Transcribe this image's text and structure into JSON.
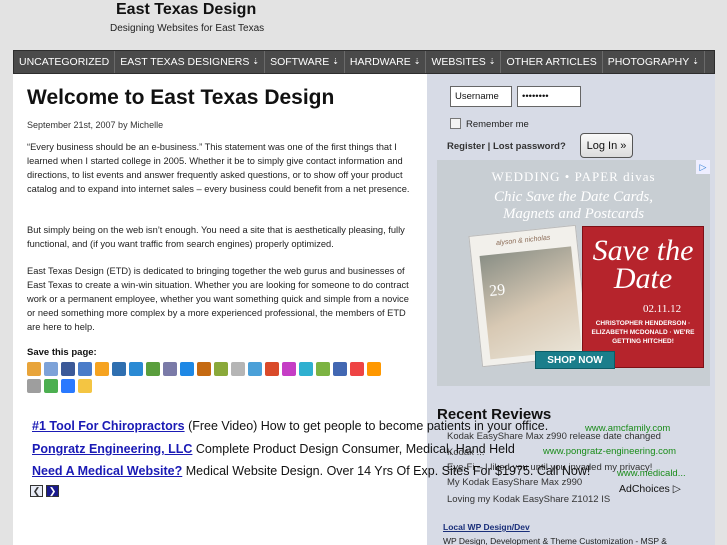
{
  "header": {
    "site_title": "East Texas Design",
    "site_description": "Designing Websites for East Texas"
  },
  "nav": {
    "items": [
      {
        "label": "UNCATEGORIZED",
        "has_submenu": false
      },
      {
        "label": "EAST TEXAS DESIGNERS",
        "has_submenu": true
      },
      {
        "label": "SOFTWARE",
        "has_submenu": true
      },
      {
        "label": "HARDWARE",
        "has_submenu": true
      },
      {
        "label": "WEBSITES",
        "has_submenu": true
      },
      {
        "label": "OTHER ARTICLES",
        "has_submenu": false
      },
      {
        "label": "PHOTOGRAPHY",
        "has_submenu": true
      }
    ]
  },
  "post": {
    "title": "Welcome to East Texas Design",
    "meta": "September 21st, 2007 by Michelle",
    "paragraphs": [
      "“Every business should be an e-business.” This statement was one of the first things that I learned when I started college in 2005. Whether it be to simply give contact information and directions, to list events and answer frequently asked questions, or to show off your product catalog and to expand into internet sales – every business could benefit from a net presence.",
      "But simply being on the web isn’t enough. You need a site that is aesthetically pleasing, fully functional, and (if you want traffic from search engines) properly optimized.",
      "East Texas Design (ETD) is dedicated to bringing together the web gurus and businesses of East Texas to create a win-win situation. Whether you are looking for someone to do contract work or a permanent employee, whether you want something quick and simple from a novice or need something more complex by a more experienced professional, the members of ETD are here to help."
    ],
    "save_label": "Save this page:",
    "share_icon_colors": [
      "#e8a43a",
      "#7da2d8",
      "#3b5998",
      "#4a7cc9",
      "#f6a320",
      "#2f6fb0",
      "#2a8ad4",
      "#5a9e3d",
      "#7a7aa8",
      "#1e88e5",
      "#c56a12",
      "#8aa93a",
      "#b5b5b5",
      "#4ba0d8",
      "#d94a2a",
      "#c53dc5",
      "#2fb0d0",
      "#7cb342",
      "#4267b2",
      "#e44",
      "#ff9800",
      "#9e9e9e",
      "#4caf50",
      "#2979ff",
      "#f4c542"
    ]
  },
  "login": {
    "username_value": "Username",
    "password_value": "••••••••",
    "remember_label": "Remember me",
    "links_text": "Register | Lost password?",
    "button_label": "Log In »"
  },
  "sidebar_ad": {
    "brand": "WEDDING • PAPER divas",
    "headline_line1": "Chic Save the Date Cards,",
    "headline_line2": "Magnets and Postcards",
    "photo_names": "alyson & nicholas",
    "photo_date": "29",
    "card_title": "Save the Date",
    "card_date": "02.11.12",
    "card_names": "CHRISTOPHER HENDERSON · ELIZABETH MCDONALD · WE'RE GETTING HITCHED!",
    "shop_label": "SHOP NOW"
  },
  "reviews": {
    "title": "Recent Reviews",
    "items": [
      "Kodak EasyShare Max z990 release date changed",
      "Kodak ...",
      "Eye-Fi – I liked you until you invaded my privacy!",
      "My Kodak EasyShare Max z990",
      "Loving my Kodak EasyShare Z1012 IS"
    ],
    "local_title": "Local WP Design/Dev",
    "local_text": "WP Design, Development & Theme Customization - MSP &"
  },
  "text_ads": [
    {
      "headline": "#1 Tool For Chiropractors",
      "text": "(Free Video) How to get people to become patients in your office.",
      "url": "www.amcfamily.com"
    },
    {
      "headline": "Pongratz Engineering, LLC",
      "text": "Complete Product Design Consumer, Medical, Hand Held",
      "url": "www.pongratz-engineering.com"
    },
    {
      "headline": "Need A Medical Website?",
      "text": "Medical Website Design. Over 14 Yrs Of Exp. Sites For $1975. Call Now!",
      "url": "www.medicald..."
    }
  ],
  "adchoices_label": "AdChoices ▷"
}
